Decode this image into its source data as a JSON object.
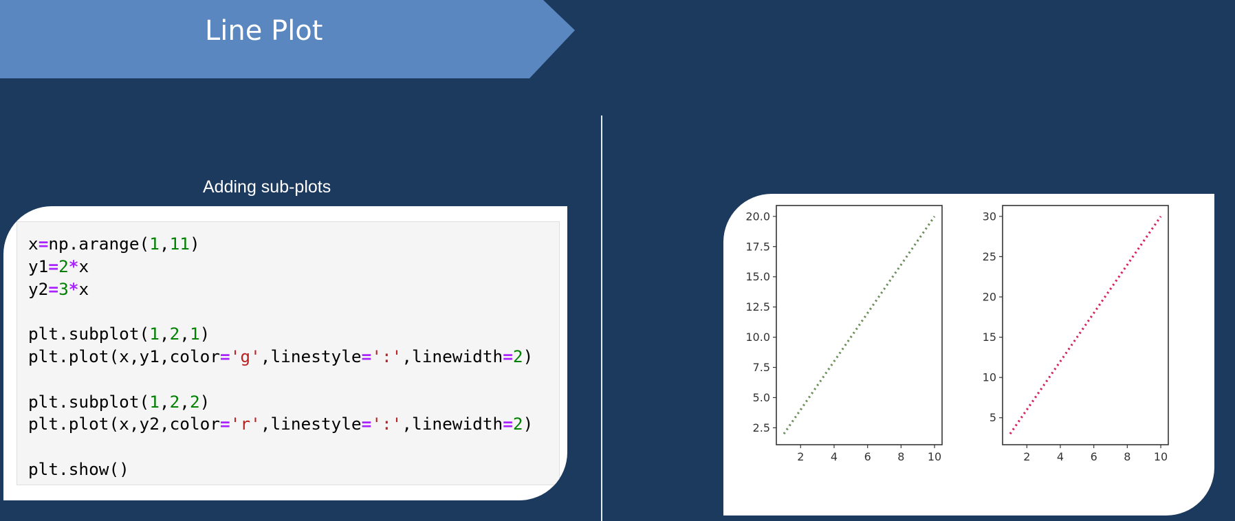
{
  "slide": {
    "title": "Line Plot",
    "subtitle": "Adding sub-plots",
    "colors": {
      "background": "#1c3a5e",
      "banner": "#5a87bf",
      "card": "#ffffff",
      "code_cell": "#f5f5f5"
    }
  },
  "code": {
    "lines": [
      [
        {
          "t": "x",
          "c": "plain"
        },
        {
          "t": "=",
          "c": "op"
        },
        {
          "t": "np.arange(",
          "c": "plain"
        },
        {
          "t": "1",
          "c": "num"
        },
        {
          "t": ",",
          "c": "plain"
        },
        {
          "t": "11",
          "c": "num"
        },
        {
          "t": ")",
          "c": "plain"
        }
      ],
      [
        {
          "t": "y1",
          "c": "plain"
        },
        {
          "t": "=",
          "c": "op"
        },
        {
          "t": "2",
          "c": "num"
        },
        {
          "t": "*",
          "c": "op"
        },
        {
          "t": "x",
          "c": "plain"
        }
      ],
      [
        {
          "t": "y2",
          "c": "plain"
        },
        {
          "t": "=",
          "c": "op"
        },
        {
          "t": "3",
          "c": "num"
        },
        {
          "t": "*",
          "c": "op"
        },
        {
          "t": "x",
          "c": "plain"
        }
      ],
      [],
      [
        {
          "t": "plt.subplot(",
          "c": "plain"
        },
        {
          "t": "1",
          "c": "num"
        },
        {
          "t": ",",
          "c": "plain"
        },
        {
          "t": "2",
          "c": "num"
        },
        {
          "t": ",",
          "c": "plain"
        },
        {
          "t": "1",
          "c": "num"
        },
        {
          "t": ")",
          "c": "plain"
        }
      ],
      [
        {
          "t": "plt.plot(x,y1,color",
          "c": "plain"
        },
        {
          "t": "=",
          "c": "op"
        },
        {
          "t": "'g'",
          "c": "str"
        },
        {
          "t": ",linestyle",
          "c": "plain"
        },
        {
          "t": "=",
          "c": "op"
        },
        {
          "t": "':'",
          "c": "str"
        },
        {
          "t": ",linewidth",
          "c": "plain"
        },
        {
          "t": "=",
          "c": "op"
        },
        {
          "t": "2",
          "c": "num"
        },
        {
          "t": ")",
          "c": "plain"
        }
      ],
      [],
      [
        {
          "t": "plt.subplot(",
          "c": "plain"
        },
        {
          "t": "1",
          "c": "num"
        },
        {
          "t": ",",
          "c": "plain"
        },
        {
          "t": "2",
          "c": "num"
        },
        {
          "t": ",",
          "c": "plain"
        },
        {
          "t": "2",
          "c": "num"
        },
        {
          "t": ")",
          "c": "plain"
        }
      ],
      [
        {
          "t": "plt.plot(x,y2,color",
          "c": "plain"
        },
        {
          "t": "=",
          "c": "op"
        },
        {
          "t": "'r'",
          "c": "str"
        },
        {
          "t": ",linestyle",
          "c": "plain"
        },
        {
          "t": "=",
          "c": "op"
        },
        {
          "t": "':'",
          "c": "str"
        },
        {
          "t": ",linewidth",
          "c": "plain"
        },
        {
          "t": "=",
          "c": "op"
        },
        {
          "t": "2",
          "c": "num"
        },
        {
          "t": ")",
          "c": "plain"
        }
      ],
      [],
      [
        {
          "t": "plt.show()",
          "c": "plain"
        }
      ]
    ]
  },
  "chart_data": [
    {
      "type": "line",
      "x": [
        1,
        2,
        3,
        4,
        5,
        6,
        7,
        8,
        9,
        10
      ],
      "series": [
        {
          "values": [
            2,
            4,
            6,
            8,
            10,
            12,
            14,
            16,
            18,
            20
          ],
          "color": "#6e8f5e",
          "linestyle": "dotted"
        }
      ],
      "xticks": [
        2,
        4,
        6,
        8,
        10
      ],
      "xtick_labels": [
        "2",
        "4",
        "6",
        "8",
        "10"
      ],
      "yticks": [
        2.5,
        5.0,
        7.5,
        10.0,
        12.5,
        15.0,
        17.5,
        20.0
      ],
      "ytick_labels": [
        "2.5",
        "5.0",
        "7.5",
        "10.0",
        "12.5",
        "15.0",
        "17.5",
        "20.0"
      ],
      "xlim": [
        0.55,
        10.45
      ],
      "ylim": [
        1.1,
        20.9
      ],
      "grid": false
    },
    {
      "type": "line",
      "x": [
        1,
        2,
        3,
        4,
        5,
        6,
        7,
        8,
        9,
        10
      ],
      "series": [
        {
          "values": [
            3,
            6,
            9,
            12,
            15,
            18,
            21,
            24,
            27,
            30
          ],
          "color": "#d6245a",
          "linestyle": "dotted"
        }
      ],
      "xticks": [
        2,
        4,
        6,
        8,
        10
      ],
      "xtick_labels": [
        "2",
        "4",
        "6",
        "8",
        "10"
      ],
      "yticks": [
        5,
        10,
        15,
        20,
        25,
        30
      ],
      "ytick_labels": [
        "5",
        "10",
        "15",
        "20",
        "25",
        "30"
      ],
      "xlim": [
        0.55,
        10.45
      ],
      "ylim": [
        1.65,
        31.35
      ],
      "grid": false
    }
  ]
}
